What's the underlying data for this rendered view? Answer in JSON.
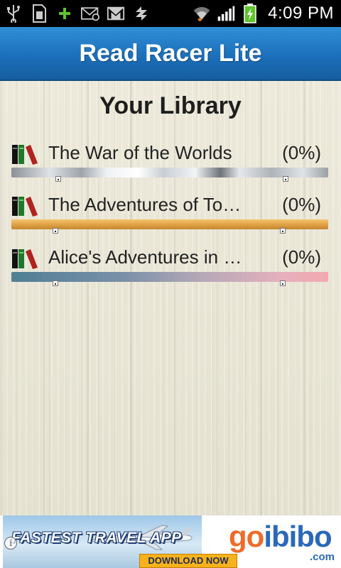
{
  "status_bar": {
    "time": "4:09 PM",
    "left_icons": [
      "usb-icon",
      "sim-card-icon",
      "plus-icon",
      "email-sync-icon",
      "gmail-icon",
      "sync-icon"
    ],
    "right_icons": [
      "wifi-icon",
      "signal-icon",
      "battery-charging-icon"
    ]
  },
  "app": {
    "title": "Read Racer Lite"
  },
  "library": {
    "heading": "Your Library",
    "books": [
      {
        "title": "The War of the Worlds",
        "progress_label": "(0%)",
        "progress": 0,
        "bar_style": "silver"
      },
      {
        "title": "The Adventures of To…",
        "progress_label": "(0%)",
        "progress": 0,
        "bar_style": "wood"
      },
      {
        "title": "Alice's Adventures in …",
        "progress_label": "(0%)",
        "progress": 0,
        "bar_style": "gradient"
      }
    ]
  },
  "ad": {
    "headline": "FASTEST TRAVEL APP",
    "cta": "DOWNLOAD NOW",
    "brand_go": "go",
    "brand_ibibo": "ibibo",
    "domain": ".com",
    "info_icon": "info-icon"
  },
  "colors": {
    "title_bar": "#1b6db8",
    "brand_orange": "#ee6b2a",
    "brand_blue": "#2a69b8"
  }
}
